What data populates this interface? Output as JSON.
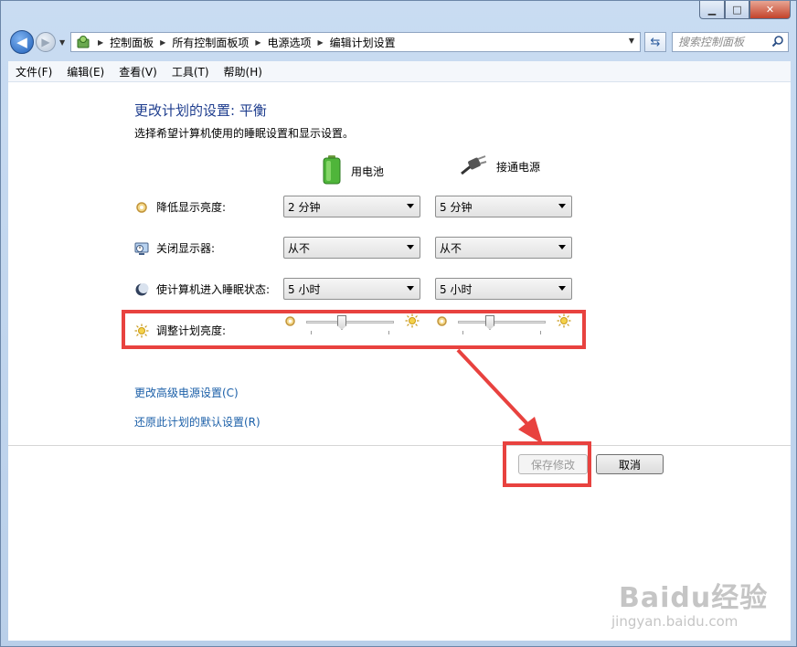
{
  "address": {
    "crumbs": [
      "控制面板",
      "所有控制面板项",
      "电源选项",
      "编辑计划设置"
    ]
  },
  "search": {
    "placeholder": "搜索控制面板"
  },
  "menu": [
    "文件(F)",
    "编辑(E)",
    "查看(V)",
    "工具(T)",
    "帮助(H)"
  ],
  "page": {
    "title": "更改计划的设置: 平衡",
    "subtitle": "选择希望计算机使用的睡眠设置和显示设置。"
  },
  "columns": {
    "battery": "用电池",
    "plugged": "接通电源"
  },
  "rows": [
    {
      "label": "降低显示亮度:",
      "battery": "2 分钟",
      "plugged": "5 分钟"
    },
    {
      "label": "关闭显示器:",
      "battery": "从不",
      "plugged": "从不"
    },
    {
      "label": "使计算机进入睡眠状态:",
      "battery": "5 小时",
      "plugged": "5 小时"
    }
  ],
  "brightness": {
    "label": "调整计划亮度:",
    "battery_level": 0.4,
    "plugged_level": 0.35
  },
  "links": {
    "advanced": "更改高级电源设置(C)",
    "restore": "还原此计划的默认设置(R)"
  },
  "buttons": {
    "save": "保存修改",
    "cancel": "取消"
  },
  "watermark": {
    "brand": "Baidu经验",
    "site": "jingyan.baidu.com"
  },
  "colors": {
    "highlight": "#e8423f",
    "link": "#1b5fa8",
    "title": "#1e3d8e"
  }
}
